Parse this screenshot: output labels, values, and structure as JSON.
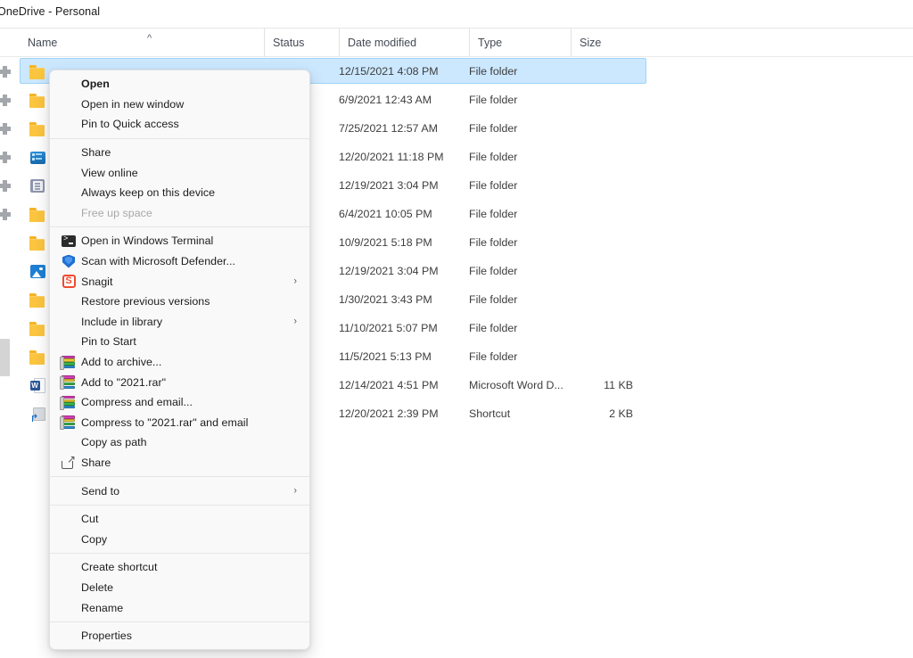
{
  "window": {
    "breadcrumb": "OneDrive - Personal"
  },
  "columns": {
    "name": "Name",
    "status": "Status",
    "date_modified": "Date modified",
    "type": "Type",
    "size": "Size",
    "sort_indicator": "^"
  },
  "files": [
    {
      "icon": "folder-icon",
      "name": "",
      "status": "",
      "date": "12/15/2021 4:08 PM",
      "type": "File folder",
      "size": "",
      "selected": true,
      "sync": true
    },
    {
      "icon": "folder-icon",
      "name": "",
      "status": "",
      "date": "6/9/2021 12:43 AM",
      "type": "File folder",
      "size": "",
      "selected": false,
      "sync": true
    },
    {
      "icon": "folder-icon",
      "name": "",
      "status": "",
      "date": "7/25/2021 12:57 AM",
      "type": "File folder",
      "size": "",
      "selected": false,
      "sync": true
    },
    {
      "icon": "screen-icon",
      "name": "",
      "status": "",
      "date": "12/20/2021 11:18 PM",
      "type": "File folder",
      "size": "",
      "selected": false,
      "sync": true
    },
    {
      "icon": "book-icon",
      "name": "",
      "status": "",
      "date": "12/19/2021 3:04 PM",
      "type": "File folder",
      "size": "",
      "selected": false,
      "sync": true
    },
    {
      "icon": "folder-icon",
      "name": "",
      "status": "",
      "date": "6/4/2021 10:05 PM",
      "type": "File folder",
      "size": "",
      "selected": false,
      "sync": true
    },
    {
      "icon": "folder-icon",
      "name": "",
      "status": "",
      "date": "10/9/2021 5:18 PM",
      "type": "File folder",
      "size": "",
      "selected": false,
      "sync": false
    },
    {
      "icon": "picture-icon",
      "name": "",
      "status": "",
      "date": "12/19/2021 3:04 PM",
      "type": "File folder",
      "size": "",
      "selected": false,
      "sync": false
    },
    {
      "icon": "folder-icon",
      "name": "",
      "status": "",
      "date": "1/30/2021 3:43 PM",
      "type": "File folder",
      "size": "",
      "selected": false,
      "sync": false
    },
    {
      "icon": "folder-icon",
      "name": "",
      "status": "",
      "date": "11/10/2021 5:07 PM",
      "type": "File folder",
      "size": "",
      "selected": false,
      "sync": false
    },
    {
      "icon": "folder-icon",
      "name": "",
      "status": "",
      "date": "11/5/2021 5:13 PM",
      "type": "File folder",
      "size": "",
      "selected": false,
      "sync": false
    },
    {
      "icon": "word-icon",
      "name": "",
      "status": "",
      "date": "12/14/2021 4:51 PM",
      "type": "Microsoft Word D...",
      "size": "11 KB",
      "selected": false,
      "sync": false
    },
    {
      "icon": "shortcut-icon",
      "name": "",
      "status": "",
      "date": "12/20/2021 2:39 PM",
      "type": "Shortcut",
      "size": "2 KB",
      "selected": false,
      "sync": false
    }
  ],
  "context_menu": {
    "groups": [
      {
        "items": [
          {
            "label": "Open",
            "icon": null,
            "bold": true,
            "disabled": false,
            "submenu": false
          },
          {
            "label": "Open in new window",
            "icon": null,
            "bold": false,
            "disabled": false,
            "submenu": false
          },
          {
            "label": "Pin to Quick access",
            "icon": null,
            "bold": false,
            "disabled": false,
            "submenu": false
          }
        ]
      },
      {
        "items": [
          {
            "label": "Share",
            "icon": null,
            "bold": false,
            "disabled": false,
            "submenu": false
          },
          {
            "label": "View online",
            "icon": null,
            "bold": false,
            "disabled": false,
            "submenu": false
          },
          {
            "label": "Always keep on this device",
            "icon": null,
            "bold": false,
            "disabled": false,
            "submenu": false
          },
          {
            "label": "Free up space",
            "icon": null,
            "bold": false,
            "disabled": true,
            "submenu": false
          }
        ]
      },
      {
        "items": [
          {
            "label": "Open in Windows Terminal",
            "icon": "terminal-icon",
            "bold": false,
            "disabled": false,
            "submenu": false
          },
          {
            "label": "Scan with Microsoft Defender...",
            "icon": "shield-icon",
            "bold": false,
            "disabled": false,
            "submenu": false
          },
          {
            "label": "Snagit",
            "icon": "snagit-icon",
            "bold": false,
            "disabled": false,
            "submenu": true
          },
          {
            "label": "Restore previous versions",
            "icon": null,
            "bold": false,
            "disabled": false,
            "submenu": false
          },
          {
            "label": "Include in library",
            "icon": null,
            "bold": false,
            "disabled": false,
            "submenu": true
          },
          {
            "label": "Pin to Start",
            "icon": null,
            "bold": false,
            "disabled": false,
            "submenu": false
          },
          {
            "label": "Add to archive...",
            "icon": "winrar-icon",
            "bold": false,
            "disabled": false,
            "submenu": false
          },
          {
            "label": "Add to \"2021.rar\"",
            "icon": "winrar-icon",
            "bold": false,
            "disabled": false,
            "submenu": false
          },
          {
            "label": "Compress and email...",
            "icon": "winrar-icon",
            "bold": false,
            "disabled": false,
            "submenu": false
          },
          {
            "label": "Compress to \"2021.rar\" and email",
            "icon": "winrar-icon",
            "bold": false,
            "disabled": false,
            "submenu": false
          },
          {
            "label": "Copy as path",
            "icon": null,
            "bold": false,
            "disabled": false,
            "submenu": false
          },
          {
            "label": "Share",
            "icon": "share-icon",
            "bold": false,
            "disabled": false,
            "submenu": false
          }
        ]
      },
      {
        "items": [
          {
            "label": "Send to",
            "icon": null,
            "bold": false,
            "disabled": false,
            "submenu": true
          }
        ]
      },
      {
        "items": [
          {
            "label": "Cut",
            "icon": null,
            "bold": false,
            "disabled": false,
            "submenu": false
          },
          {
            "label": "Copy",
            "icon": null,
            "bold": false,
            "disabled": false,
            "submenu": false
          }
        ]
      },
      {
        "items": [
          {
            "label": "Create shortcut",
            "icon": null,
            "bold": false,
            "disabled": false,
            "submenu": false
          },
          {
            "label": "Delete",
            "icon": null,
            "bold": false,
            "disabled": false,
            "submenu": false
          },
          {
            "label": "Rename",
            "icon": null,
            "bold": false,
            "disabled": false,
            "submenu": false
          }
        ]
      },
      {
        "items": [
          {
            "label": "Properties",
            "icon": null,
            "bold": false,
            "disabled": false,
            "submenu": false
          }
        ]
      }
    ],
    "submenu_arrow": "›"
  },
  "colors": {
    "selection": "#cce8ff",
    "selection_border": "#9fd4f7",
    "menu_bg": "#f9f9f9",
    "folder": "#fbc53f"
  }
}
